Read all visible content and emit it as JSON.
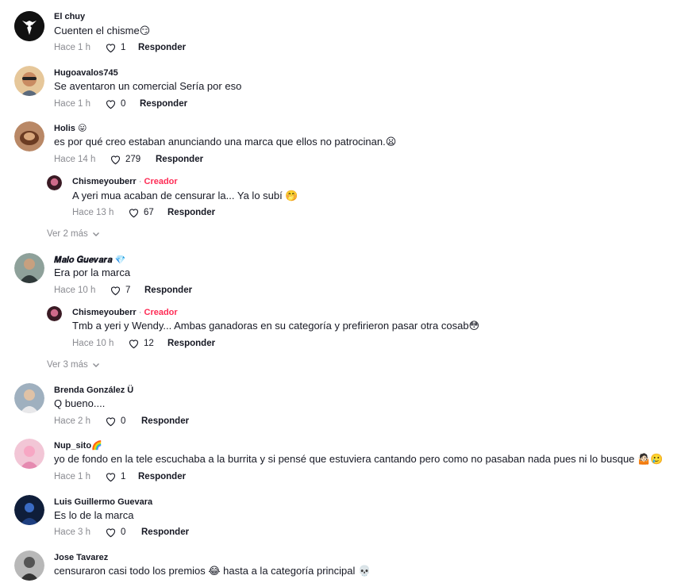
{
  "ui": {
    "reply_label": "Responder",
    "creator_label": "Creador",
    "dot": "·"
  },
  "comments": [
    {
      "user": "El chuy",
      "text": "Cuenten el chisme😏",
      "time": "Hace 1 h",
      "likes": "1"
    },
    {
      "user": "Hugoavalos745",
      "text": "Se aventaron un comercial Sería por eso",
      "time": "Hace 1 h",
      "likes": "0"
    },
    {
      "user": "Holis 😛",
      "text": "es por qué creo estaban anunciando una marca que ellos no patrocinan.😦",
      "time": "Hace 14 h",
      "likes": "279",
      "reply": {
        "user": "Chismeyouberr",
        "text": "A yeri mua acaban de censurar la... Ya lo subí 🤭",
        "time": "Hace 13 h",
        "likes": "67"
      },
      "more": "Ver 2 más"
    },
    {
      "user": "𝑴𝒂𝒍𝒐 𝑮𝒖𝒆𝒗𝒂𝒓𝒂 💎",
      "text": "Era por la marca",
      "time": "Hace 10 h",
      "likes": "7",
      "reply": {
        "user": "Chismeyouberr",
        "text": "Tmb a yeri y Wendy... Ambas ganadoras en su categoría y prefirieron pasar otra cosab😳",
        "time": "Hace 10 h",
        "likes": "12"
      },
      "more": "Ver 3 más"
    },
    {
      "user": "Brenda González Ü",
      "text": "Q bueno....",
      "time": "Hace 2 h",
      "likes": "0"
    },
    {
      "user": "Nup_sito🌈",
      "text": "yo de fondo en la tele escuchaba a la burrita y si pensé que estuviera cantando pero como no pasaban nada pues ni lo busque 🤷🏻🥲",
      "time": "Hace 1 h",
      "likes": "1"
    },
    {
      "user": "Luis Guillermo Guevara",
      "text": "Es lo de la marca",
      "time": "Hace 3 h",
      "likes": "0"
    },
    {
      "user": "Jose Tavarez",
      "text": "censuraron casi todo los premios 😂 hasta a la categoría principal 💀"
    }
  ]
}
